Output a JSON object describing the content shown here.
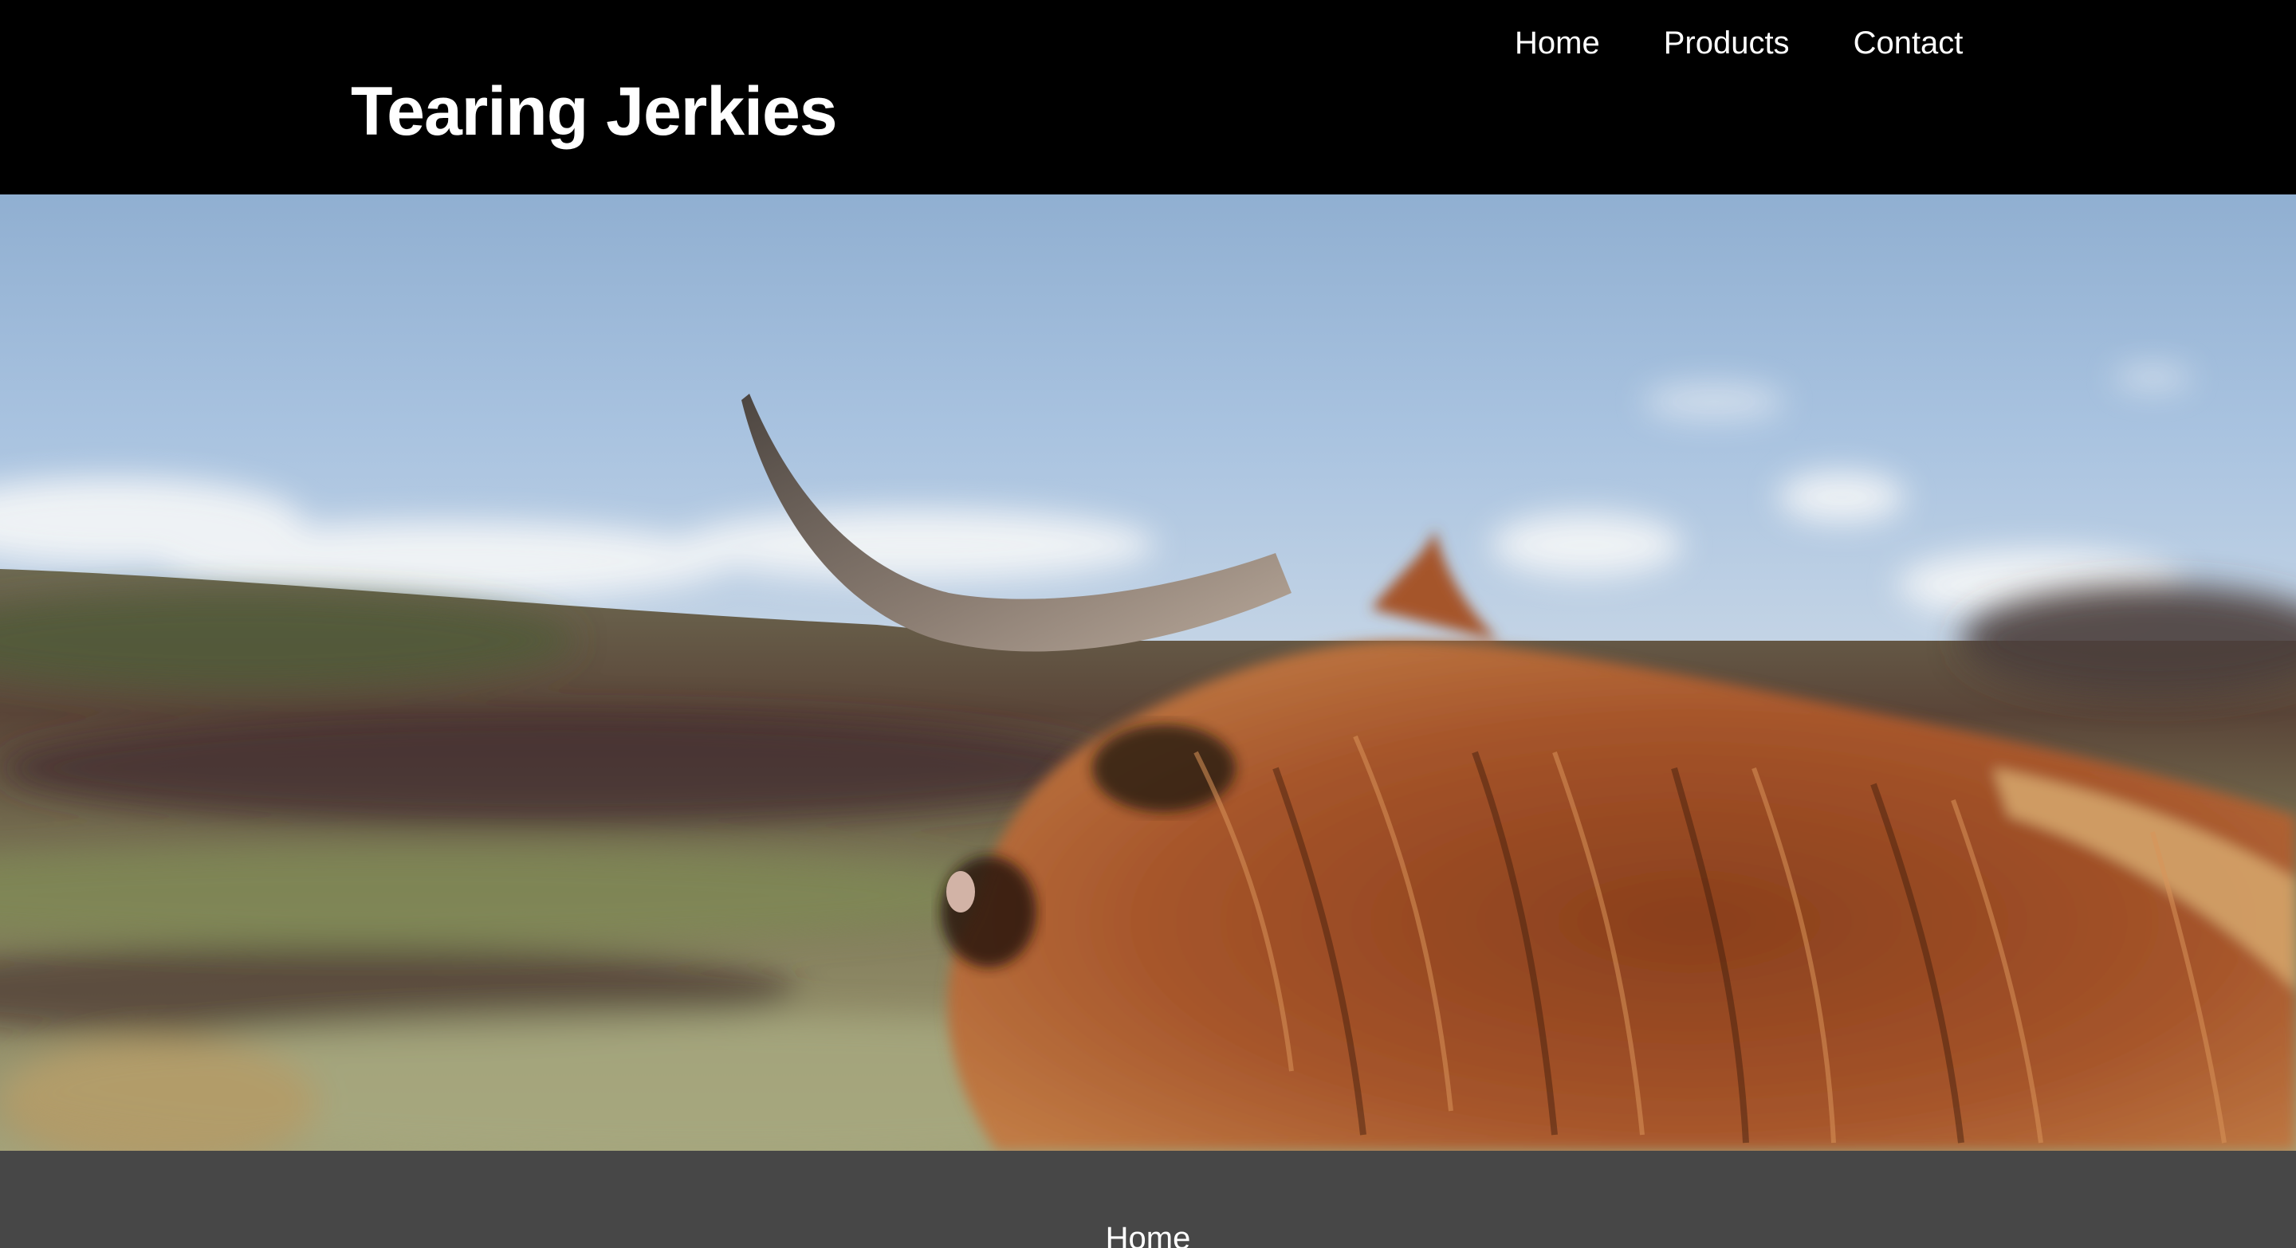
{
  "header": {
    "brand": "Tearing Jerkies",
    "nav": [
      {
        "label": "Home"
      },
      {
        "label": "Products"
      },
      {
        "label": "Contact"
      }
    ]
  },
  "hero": {
    "image": "highland-cow-photo"
  },
  "footer": {
    "link": "Home"
  },
  "colors": {
    "header_bg": "#000000",
    "footer_bg": "#474747",
    "text": "#ffffff"
  }
}
